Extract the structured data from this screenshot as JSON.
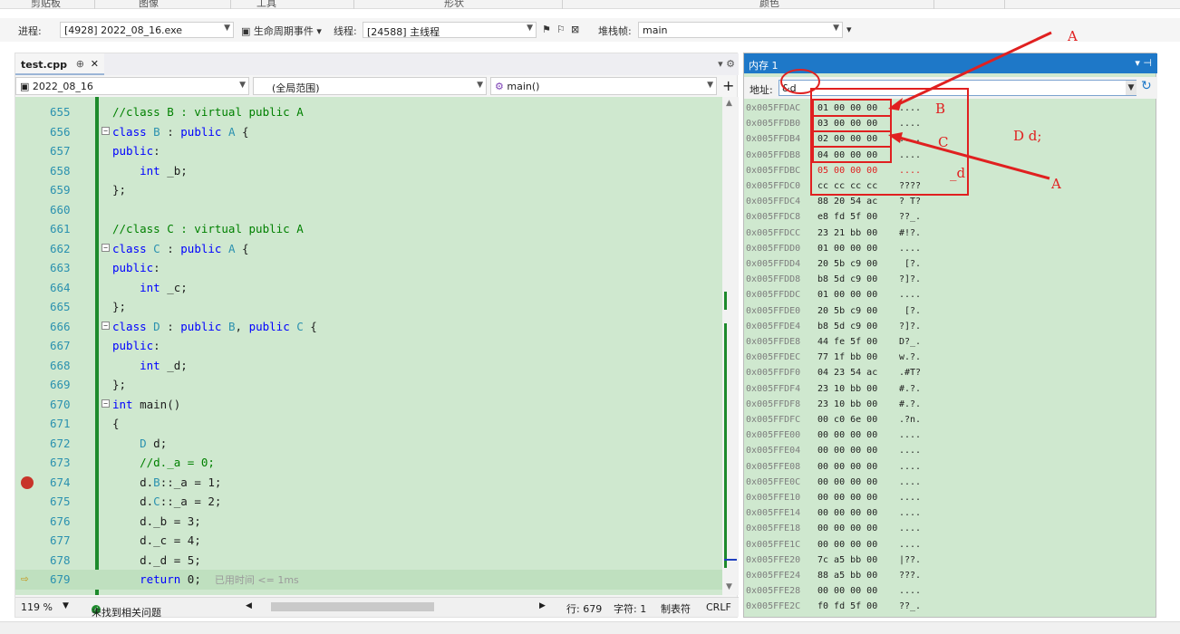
{
  "ribbon": {
    "labels": [
      "剪贴板",
      "图像",
      "工具",
      "形状",
      "颜色"
    ]
  },
  "debug_toolbar": {
    "process_label": "进程:",
    "process_value": "[4928] 2022_08_16.exe",
    "lifecycle_label": "生命周期事件",
    "thread_label": "线程:",
    "thread_value": "[24588] 主线程",
    "stack_label": "堆栈帧:",
    "stack_value": "main"
  },
  "editor": {
    "tab_label": "test.cpp",
    "nav_project": "2022_08_16",
    "nav_scope": "(全局范围)",
    "nav_function": "main()",
    "lines": [
      {
        "num": "655",
        "html": "<span class=\"cm\">//class B : virtual public A</span>",
        "fold": false
      },
      {
        "num": "656",
        "html": "<span class=\"kw\">class</span> <span class=\"ty\">B</span> : <span class=\"kw\">public</span> <span class=\"ty\">A</span> {",
        "fold": true
      },
      {
        "num": "657",
        "html": "<span class=\"kw\">public</span>:",
        "fold": false
      },
      {
        "num": "658",
        "html": "    <span class=\"kw\">int</span> _b;",
        "fold": false
      },
      {
        "num": "659",
        "html": "};",
        "fold": false
      },
      {
        "num": "660",
        "html": "",
        "fold": false
      },
      {
        "num": "661",
        "html": "<span class=\"cm\">//class C : virtual public A</span>",
        "fold": false
      },
      {
        "num": "662",
        "html": "<span class=\"kw\">class</span> <span class=\"ty\">C</span> : <span class=\"kw\">public</span> <span class=\"ty\">A</span> {",
        "fold": true
      },
      {
        "num": "663",
        "html": "<span class=\"kw\">public</span>:",
        "fold": false
      },
      {
        "num": "664",
        "html": "    <span class=\"kw\">int</span> _c;",
        "fold": false
      },
      {
        "num": "665",
        "html": "};",
        "fold": false
      },
      {
        "num": "666",
        "html": "<span class=\"kw\">class</span> <span class=\"ty\">D</span> : <span class=\"kw\">public</span> <span class=\"ty\">B</span>, <span class=\"kw\">public</span> <span class=\"ty\">C</span> {",
        "fold": true
      },
      {
        "num": "667",
        "html": "<span class=\"kw\">public</span>:",
        "fold": false
      },
      {
        "num": "668",
        "html": "    <span class=\"kw\">int</span> _d;",
        "fold": false
      },
      {
        "num": "669",
        "html": "};",
        "fold": false
      },
      {
        "num": "670",
        "html": "<span class=\"kw\">int</span> main()",
        "fold": true
      },
      {
        "num": "671",
        "html": "{",
        "fold": false
      },
      {
        "num": "672",
        "html": "    <span class=\"ty\">D</span> d;",
        "fold": false
      },
      {
        "num": "673",
        "html": "    <span class=\"cm\">//d._a = 0;</span>",
        "fold": false
      },
      {
        "num": "674",
        "html": "    d.<span class=\"ty\">B</span>::_a = 1;",
        "fold": false,
        "breakpoint": true
      },
      {
        "num": "675",
        "html": "    d.<span class=\"ty\">C</span>::_a = 2;",
        "fold": false
      },
      {
        "num": "676",
        "html": "    d._b = 3;",
        "fold": false
      },
      {
        "num": "677",
        "html": "    d._c = 4;",
        "fold": false
      },
      {
        "num": "678",
        "html": "    d._d = 5;",
        "fold": false
      },
      {
        "num": "679",
        "html": "    <span class=\"kw\">return</span> 0;  <span class=\"ann\">已用时间 &lt;= 1ms</span>",
        "fold": false,
        "current": true
      }
    ]
  },
  "status": {
    "zoom": "119 %",
    "issues": "未找到相关问题",
    "row": "行: 679",
    "col": "字符: 1",
    "tabs": "制表符",
    "eol": "CRLF"
  },
  "memory": {
    "title": "内存 1",
    "address_label": "地址:",
    "address_value": "&d",
    "rows": [
      {
        "addr": "0x005FFDAC",
        "bytes": "01 00 00 00",
        "ascii": "...."
      },
      {
        "addr": "0x005FFDB0",
        "bytes": "03 00 00 00",
        "ascii": "...."
      },
      {
        "addr": "0x005FFDB4",
        "bytes": "02 00 00 00",
        "ascii": "...."
      },
      {
        "addr": "0x005FFDB8",
        "bytes": "04 00 00 00",
        "ascii": "...."
      },
      {
        "addr": "0x005FFDBC",
        "bytes": "05 00 00 00",
        "ascii": "....",
        "red": true
      },
      {
        "addr": "0x005FFDC0",
        "bytes": "cc cc cc cc",
        "ascii": "????"
      },
      {
        "addr": "0x005FFDC4",
        "bytes": "88 20 54 ac",
        "ascii": "? T?"
      },
      {
        "addr": "0x005FFDC8",
        "bytes": "e8 fd 5f 00",
        "ascii": "??_."
      },
      {
        "addr": "0x005FFDCC",
        "bytes": "23 21 bb 00",
        "ascii": "#!?."
      },
      {
        "addr": "0x005FFDD0",
        "bytes": "01 00 00 00",
        "ascii": "...."
      },
      {
        "addr": "0x005FFDD4",
        "bytes": "20 5b c9 00",
        "ascii": " [?."
      },
      {
        "addr": "0x005FFDD8",
        "bytes": "b8 5d c9 00",
        "ascii": "?]?."
      },
      {
        "addr": "0x005FFDDC",
        "bytes": "01 00 00 00",
        "ascii": "...."
      },
      {
        "addr": "0x005FFDE0",
        "bytes": "20 5b c9 00",
        "ascii": " [?."
      },
      {
        "addr": "0x005FFDE4",
        "bytes": "b8 5d c9 00",
        "ascii": "?]?."
      },
      {
        "addr": "0x005FFDE8",
        "bytes": "44 fe 5f 00",
        "ascii": "D?_."
      },
      {
        "addr": "0x005FFDEC",
        "bytes": "77 1f bb 00",
        "ascii": "w.?."
      },
      {
        "addr": "0x005FFDF0",
        "bytes": "04 23 54 ac",
        "ascii": ".#T?"
      },
      {
        "addr": "0x005FFDF4",
        "bytes": "23 10 bb 00",
        "ascii": "#.?."
      },
      {
        "addr": "0x005FFDF8",
        "bytes": "23 10 bb 00",
        "ascii": "#.?."
      },
      {
        "addr": "0x005FFDFC",
        "bytes": "00 c0 6e 00",
        "ascii": ".?n."
      },
      {
        "addr": "0x005FFE00",
        "bytes": "00 00 00 00",
        "ascii": "...."
      },
      {
        "addr": "0x005FFE04",
        "bytes": "00 00 00 00",
        "ascii": "...."
      },
      {
        "addr": "0x005FFE08",
        "bytes": "00 00 00 00",
        "ascii": "...."
      },
      {
        "addr": "0x005FFE0C",
        "bytes": "00 00 00 00",
        "ascii": "...."
      },
      {
        "addr": "0x005FFE10",
        "bytes": "00 00 00 00",
        "ascii": "...."
      },
      {
        "addr": "0x005FFE14",
        "bytes": "00 00 00 00",
        "ascii": "...."
      },
      {
        "addr": "0x005FFE18",
        "bytes": "00 00 00 00",
        "ascii": "...."
      },
      {
        "addr": "0x005FFE1C",
        "bytes": "00 00 00 00",
        "ascii": "...."
      },
      {
        "addr": "0x005FFE20",
        "bytes": "7c a5 bb 00",
        "ascii": "|??."
      },
      {
        "addr": "0x005FFE24",
        "bytes": "88 a5 bb 00",
        "ascii": "???."
      },
      {
        "addr": "0x005FFE28",
        "bytes": "00 00 00 00",
        "ascii": "...."
      },
      {
        "addr": "0x005FFE2C",
        "bytes": "f0 fd 5f 00",
        "ascii": "??_."
      }
    ]
  },
  "annotations": {
    "label_a_top": "A",
    "label_a_bottom": "A",
    "label_b": "B",
    "label_c": "C",
    "label_d": "_d",
    "label_dd": "D d;"
  },
  "colors": {
    "code_bg": "#cfe8cf",
    "keyword": "#0000ff",
    "comment": "#008000",
    "type": "#2b91af",
    "annotation_red": "#e02020",
    "memory_title": "#1e78c8"
  }
}
